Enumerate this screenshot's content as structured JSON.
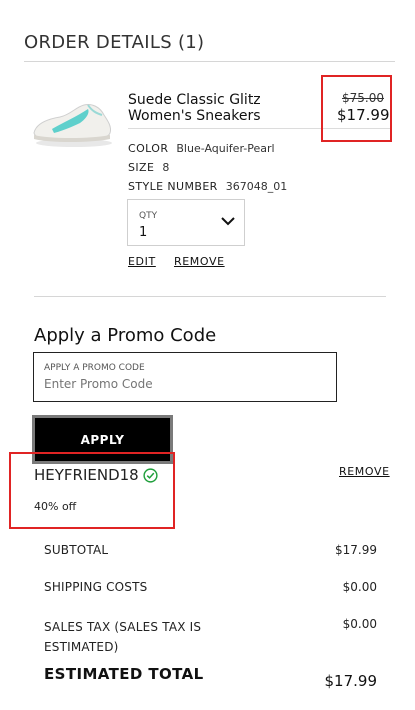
{
  "header": {
    "title": "ORDER DETAILS (1)"
  },
  "product": {
    "name_line1": "Suede Classic Glitz",
    "name_line2": "Women's Sneakers",
    "price_old": "$75.00",
    "price_new": "$17.99",
    "attributes": [
      {
        "key": "COLOR",
        "value": "Blue-Aquifer-Pearl"
      },
      {
        "key": "SIZE",
        "value": "8"
      },
      {
        "key": "STYLE NUMBER",
        "value": "367048_01"
      }
    ],
    "qty_label": "QTY",
    "qty_value": "1",
    "edit_label": "EDIT",
    "remove_label": "REMOVE"
  },
  "promo": {
    "title": "Apply a Promo Code",
    "field_label": "APPLY A PROMO CODE",
    "placeholder": "Enter Promo Code",
    "apply_label": "APPLY",
    "applied_code": "HEYFRIEND18",
    "discount_text": "40% off",
    "remove_label": "REMOVE"
  },
  "summary": {
    "subtotal_label": "SUBTOTAL",
    "subtotal_value": "$17.99",
    "shipping_label": "SHIPPING COSTS",
    "shipping_value": "$0.00",
    "tax_label_line1": "SALES TAX (SALES TAX IS",
    "tax_label_line2": "ESTIMATED)",
    "tax_value": "$0.00",
    "total_label": "ESTIMATED TOTAL",
    "total_value": "$17.99"
  },
  "colors": {
    "highlight": "#e02424",
    "check": "#1e9e3a",
    "shoe_accent": "#5fd0cc"
  }
}
